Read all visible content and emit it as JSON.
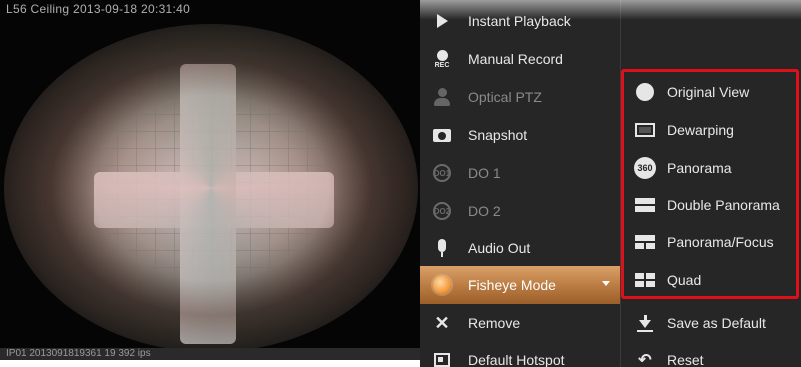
{
  "camera": {
    "title": "L56 Ceiling   2013-09-18 20:31:40",
    "footer": "IP01  2013091819361  19  392 ips"
  },
  "menu": {
    "items": [
      {
        "label": "Instant Playback",
        "icon": "play-icon",
        "enabled": true
      },
      {
        "label": "Manual Record",
        "icon": "rec-icon",
        "enabled": true
      },
      {
        "label": "Optical PTZ",
        "icon": "ptz-person-icon",
        "enabled": false
      },
      {
        "label": "Snapshot",
        "icon": "camera-icon",
        "enabled": true
      },
      {
        "label": "DO 1",
        "icon": "do1-icon",
        "enabled": false
      },
      {
        "label": "DO 2",
        "icon": "do2-icon",
        "enabled": false
      },
      {
        "label": "Audio Out",
        "icon": "microphone-icon",
        "enabled": true
      },
      {
        "label": "Fisheye Mode",
        "icon": "fisheye-icon",
        "enabled": true,
        "active": true
      },
      {
        "label": "Remove",
        "icon": "close-icon",
        "enabled": true
      },
      {
        "label": "Default Hotspot",
        "icon": "hotspot-icon",
        "enabled": true
      }
    ],
    "rec_text": "REC",
    "do1_text": "DO1",
    "do2_text": "DO2"
  },
  "submenu": {
    "items": [
      {
        "label": "Original View",
        "icon": "circle-icon"
      },
      {
        "label": "Dewarping",
        "icon": "dewarp-rect-icon"
      },
      {
        "label": "Panorama",
        "icon": "panorama-360-icon"
      },
      {
        "label": "Double Panorama",
        "icon": "double-panorama-icon"
      },
      {
        "label": "Panorama/Focus",
        "icon": "panorama-focus-icon"
      },
      {
        "label": "Quad",
        "icon": "quad-icon"
      },
      {
        "label": "Save as Default",
        "icon": "download-icon"
      },
      {
        "label": "Reset",
        "icon": "reset-icon"
      }
    ],
    "panorama_badge": "360"
  },
  "colors": {
    "menu_bg": "#262626",
    "active_item": "#b97a41",
    "highlight_box": "#e0101b"
  }
}
